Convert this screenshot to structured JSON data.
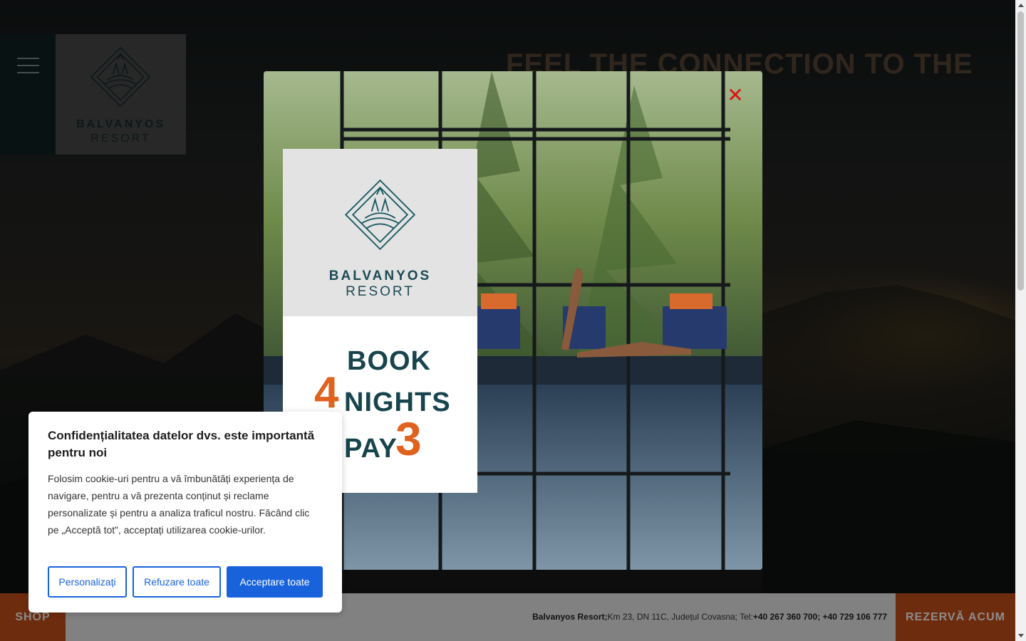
{
  "hero": {
    "title": "FEEL THE CONNECTION TO THE"
  },
  "header": {
    "logo_line1": "BALVANYOS",
    "logo_line2": "RESORT"
  },
  "popup": {
    "logo_line1": "BALVANYOS",
    "logo_line2": "RESORT",
    "promo_book": "BOOK",
    "promo_four": "4",
    "promo_nights": "NIGHTS",
    "promo_pay": "PAY",
    "promo_three": "3",
    "close_label": "✕"
  },
  "cookie": {
    "title": "Confidențialitatea datelor dvs. este importantă pentru noi",
    "body": "Folosim cookie-uri pentru a vă îmbunătăți experiența de navigare, pentru a vă prezenta conținut și reclame personalizate și pentru a analiza traficul nostru. Făcând clic pe „Acceptă tot”, acceptați utilizarea cookie-urilor.",
    "customize": "Personalizați",
    "reject": "Refuzare toate",
    "accept": "Acceptare toate"
  },
  "footer": {
    "shop": "SHOP",
    "resort_name": "Balvanyos Resort;",
    "address": "Km 23, DN 11C, Județul Covasna; Tel:",
    "phones": "+40 267 360 700; +40 729 106 777",
    "book_now": "REZERVĂ ACUM"
  },
  "colors": {
    "accent_orange": "#c8501b",
    "brand_teal": "#17444d",
    "cookie_blue": "#1863dc",
    "close_red": "#e01010"
  }
}
